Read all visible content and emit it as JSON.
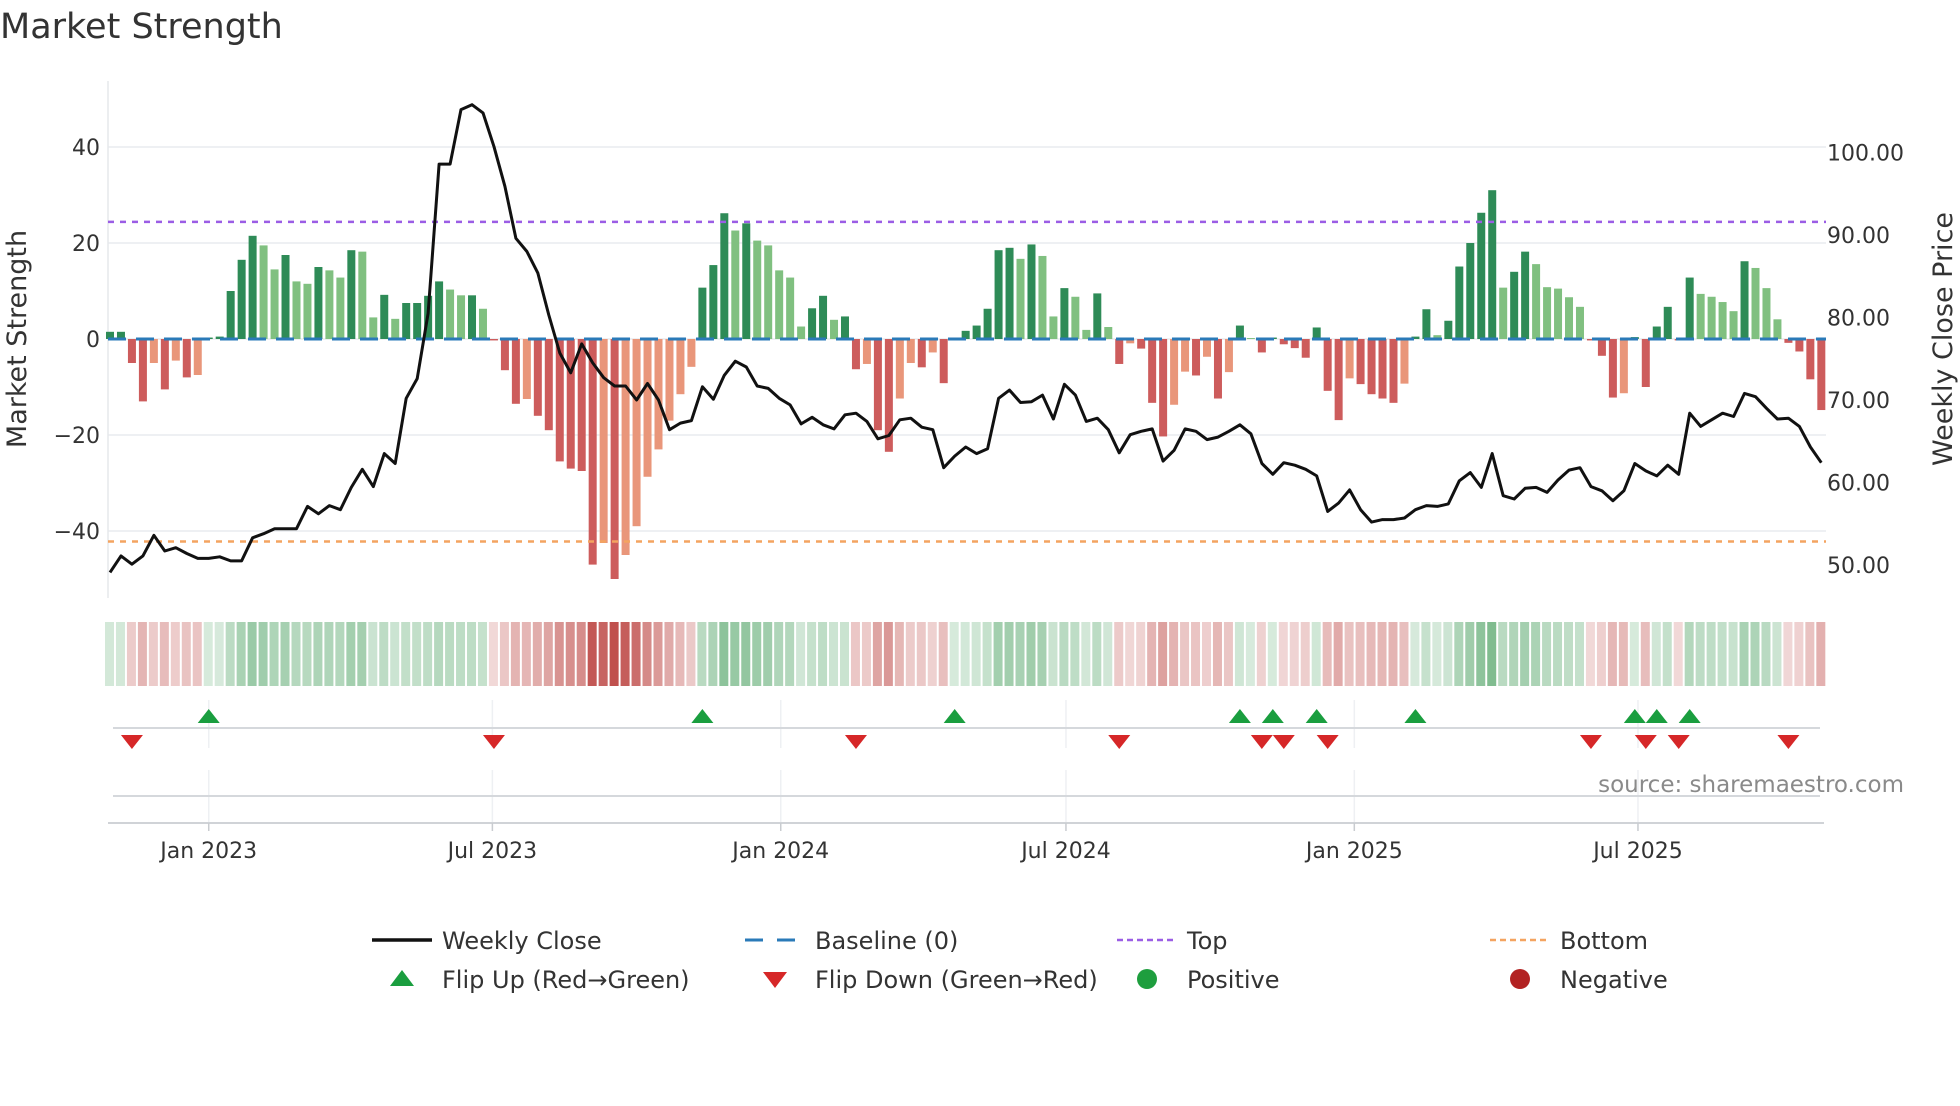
{
  "title": "Market Strength",
  "source": "source: sharemaestro.com",
  "colors": {
    "pos_strong": "#2e8b57",
    "pos_weak": "#80c080",
    "neg_strong": "#cd5c5c",
    "neg_weak": "#e9967a",
    "close": "#111111",
    "baseline": "#2a7ab8",
    "top": "#9b5de5",
    "bottom": "#f4a460",
    "flip_up": "#1a9e3f",
    "flip_down": "#d62728",
    "positive": "#1e9e3e",
    "negative": "#b22222"
  },
  "legend": [
    {
      "key": "close",
      "label": "Weekly Close"
    },
    {
      "key": "baseline",
      "label": "Baseline (0)"
    },
    {
      "key": "top",
      "label": "Top"
    },
    {
      "key": "bottom",
      "label": "Bottom"
    },
    {
      "key": "flip_up",
      "label": "Flip Up (Red→Green)"
    },
    {
      "key": "flip_down",
      "label": "Flip Down (Green→Red)"
    },
    {
      "key": "positive",
      "label": "Positive"
    },
    {
      "key": "negative",
      "label": "Negative"
    }
  ],
  "chart_data": {
    "type": "bar",
    "title": "Market Strength",
    "ylabel": "Market Strength",
    "y2label": "Weekly Close Price",
    "ylim": [
      -52,
      52
    ],
    "y2lim": [
      47.5,
      111
    ],
    "yticks": [
      40,
      20,
      0,
      -20,
      -40
    ],
    "y2ticks": [
      "100.00",
      "90.00",
      "80.00",
      "70.00",
      "60.00",
      "50.00"
    ],
    "start_date": "2022-10-30",
    "frequency": "weekly",
    "xticks": [
      {
        "label": "Jan 2023",
        "date": "2023-01-01"
      },
      {
        "label": "Jul 2023",
        "date": "2023-07-01"
      },
      {
        "label": "Jan 2024",
        "date": "2024-01-01"
      },
      {
        "label": "Jul 2024",
        "date": "2024-07-01"
      },
      {
        "label": "Jan 2025",
        "date": "2025-01-01"
      },
      {
        "label": "Jul 2025",
        "date": "2025-07-01"
      }
    ],
    "top_level": 24.4,
    "bottom_level": -42.2,
    "baseline": 0,
    "strength": [
      1.5,
      1.5,
      -5,
      -13,
      -5,
      -10.5,
      -4.5,
      -8,
      -7.5,
      0.3,
      0.5,
      10,
      16.5,
      21.5,
      19.5,
      14.5,
      17.5,
      12,
      11.5,
      15,
      14.3,
      12.8,
      18.5,
      18.2,
      4.5,
      9.2,
      4.2,
      7.5,
      7.5,
      9,
      12,
      10.3,
      9.1,
      9.1,
      6.3,
      -0.3,
      -6.5,
      -13.5,
      -12.5,
      -16,
      -19,
      -25.5,
      -27,
      -27.5,
      -47,
      -42.5,
      -50,
      -45,
      -39,
      -28.7,
      -23,
      -17,
      -11.5,
      -5.8,
      10.7,
      15.4,
      26.2,
      22.6,
      24.1,
      20.5,
      19.5,
      14.3,
      12.8,
      2.6,
      6.4,
      9,
      4,
      4.7,
      -6.3,
      -5.2,
      -19,
      -23.5,
      -12.4,
      -5,
      -5.9,
      -2.8,
      -9.2,
      0.3,
      1.7,
      2.8,
      6.3,
      18.5,
      19,
      16.7,
      19.7,
      17.3,
      4.7,
      10.6,
      8.8,
      1.9,
      9.5,
      2.5,
      -5.2,
      -0.9,
      -2,
      -13.3,
      -20.3,
      -13.7,
      -6.8,
      -7.6,
      -3.7,
      -12.4,
      -6.9,
      2.8,
      0.2,
      -2.8,
      0.3,
      -1.1,
      -1.9,
      -3.9,
      2.4,
      -10.8,
      -16.9,
      -8.2,
      -9.4,
      -11.5,
      -12.4,
      -13.3,
      -9.3,
      0.5,
      6.2,
      0.8,
      3.8,
      15.1,
      20,
      26.3,
      31,
      10.7,
      14,
      18.2,
      15.6,
      10.8,
      10.5,
      8.7,
      6.7,
      -0.3,
      -3.5,
      -12.2,
      -11.3,
      0.4,
      -10,
      2.6,
      6.7,
      -0.3,
      12.8,
      9.4,
      8.8,
      7.7,
      5.8,
      16.2,
      14.8,
      10.6,
      4.1,
      -0.8,
      -2.6,
      -8.4,
      -14.8
    ],
    "close": [
      49.1,
      51.1,
      50.1,
      51.1,
      53.6,
      51.7,
      52.1,
      51.4,
      50.8,
      50.8,
      51.0,
      50.5,
      50.5,
      53.3,
      53.8,
      54.4,
      54.4,
      54.4,
      57.1,
      56.2,
      57.2,
      56.7,
      59.4,
      61.6,
      59.5,
      63.5,
      62.3,
      70.2,
      72.6,
      80.5,
      98.6,
      98.6,
      105.2,
      105.8,
      104.8,
      100.7,
      95.9,
      89.6,
      88.0,
      85.4,
      80.3,
      75.7,
      73.3,
      76.8,
      74.5,
      72.7,
      71.7,
      71.7,
      70.0,
      72.0,
      70.0,
      66.4,
      67.2,
      67.5,
      71.6,
      70.1,
      73.0,
      74.7,
      74.0,
      71.7,
      71.4,
      70.2,
      69.4,
      67.1,
      67.9,
      67.0,
      66.5,
      68.2,
      68.4,
      67.4,
      65.3,
      65.7,
      67.6,
      67.8,
      66.7,
      66.4,
      61.8,
      63.2,
      64.3,
      63.5,
      64.1,
      70.2,
      71.2,
      69.7,
      69.8,
      70.6,
      67.7,
      71.9,
      70.6,
      67.4,
      67.8,
      66.4,
      63.6,
      65.8,
      66.2,
      66.5,
      62.6,
      63.9,
      66.5,
      66.2,
      65.2,
      65.5,
      66.2,
      67.0,
      65.9,
      62.3,
      61.0,
      62.4,
      62.1,
      61.6,
      60.8,
      56.5,
      57.5,
      59.1,
      56.7,
      55.2,
      55.5,
      55.5,
      55.7,
      56.7,
      57.2,
      57.1,
      57.4,
      60.2,
      61.2,
      59.4,
      63.5,
      58.4,
      58.0,
      59.3,
      59.4,
      58.8,
      60.3,
      61.5,
      61.8,
      59.5,
      59.0,
      57.8,
      59.0,
      62.3,
      61.4,
      60.8,
      62.1,
      61.0,
      68.4,
      66.8,
      67.6,
      68.4,
      68.0,
      70.8,
      70.4,
      69.0,
      67.7,
      67.8,
      66.8,
      64.3,
      62.4
    ],
    "flip_up_weeks": [
      9,
      54,
      77,
      103,
      106,
      110,
      119,
      139,
      141,
      144
    ],
    "flip_down_weeks": [
      2,
      35,
      68,
      92,
      105,
      107,
      111,
      135,
      140,
      143,
      153
    ]
  }
}
